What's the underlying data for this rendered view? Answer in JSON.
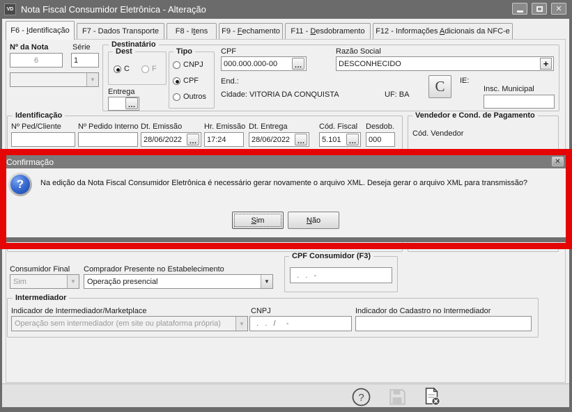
{
  "window": {
    "icon_text": "VD",
    "title": "Nota Fiscal Consumidor Eletrônica - Alteração"
  },
  "tabs": [
    {
      "label": "F6 - Identificação",
      "u": 5,
      "active": true
    },
    {
      "label": "F7 - Dados Transporte",
      "u": -1,
      "active": false
    },
    {
      "label": "F8 - Itens",
      "u": 6,
      "active": false
    },
    {
      "label": "F9 - Fechamento",
      "u": 5,
      "active": false
    },
    {
      "label": "F11 - Desdobramento",
      "u": 6,
      "active": false
    },
    {
      "label": "F12 - Informações Adicionais da NFC-e",
      "u": 18,
      "active": false
    }
  ],
  "form": {
    "nota": {
      "label": "Nº da Nota",
      "value": "6"
    },
    "serie": {
      "label": "Série",
      "value": "1"
    },
    "destinatario": {
      "title": "Destinatário",
      "dest": {
        "title": "Dest",
        "option_c": "C",
        "option_f": "F",
        "selected": "C"
      },
      "entrega_label": "Entrega",
      "entrega_value": "",
      "tipo": {
        "title": "Tipo",
        "options": [
          "CNPJ",
          "CPF",
          "Outros"
        ],
        "selected": "CPF"
      },
      "cpf": {
        "label": "CPF",
        "value": "000.000.000-00"
      },
      "razao_social": {
        "label": "Razão Social",
        "value": "DESCONHECIDO"
      },
      "end_label": "End.:",
      "cidade_text": "Cidade: VITORIA DA CONQUISTA",
      "uf_text": "UF: BA",
      "c_button_label": "C",
      "ie_label": "IE:",
      "insc_municipal_label": "Insc. Municipal",
      "insc_municipal_value": ""
    },
    "identificacao": {
      "title": "Identificação",
      "fields": [
        {
          "label": "Nº Ped/Cliente",
          "value": ""
        },
        {
          "label": "Nº Pedido Interno",
          "value": ""
        },
        {
          "label": "Dt. Emissão",
          "value": "28/06/2022"
        },
        {
          "label": "Hr. Emissão",
          "value": "17:24"
        },
        {
          "label": "Dt. Entrega",
          "value": "28/06/2022"
        },
        {
          "label": "Cód. Fiscal",
          "value": "5.101"
        },
        {
          "label": "Desdob.",
          "value": "000"
        }
      ]
    },
    "vendedor": {
      "title": "Vendedor e Cond. de Pagamento",
      "cod_vendedor_label": "Cód. Vendedor"
    },
    "consumidor": {
      "final_label": "Consumidor Final",
      "final_value": "Sim",
      "comprador_label": "Comprador Presente no Estabelecimento",
      "comprador_value": "Operação presencial",
      "cpf_group_title": "CPF Consumidor (F3)",
      "cpf_mask": "  .   .   -"
    },
    "intermediador": {
      "title": "Intermediador",
      "indicador_label": "Indicador de Intermediador/Marketplace",
      "indicador_value": "Operação sem intermediador (em site ou plataforma própria)",
      "cnpj_label": "CNPJ",
      "cnpj_mask": "  .   .   /     -",
      "cadastro_label": "Indicador do Cadastro no Intermediador",
      "cadastro_value": ""
    }
  },
  "dialog": {
    "title": "Confirmação",
    "message": "Na edição da Nota Fiscal Consumidor Eletrônica é necessário gerar novamente o arquivo XML. Deseja gerar o arquivo XML para transmissão?",
    "yes_label": "Sim",
    "yes_u": 0,
    "no_label": "Não",
    "no_u": 0
  },
  "colors": {
    "highlight_red": "#e60505",
    "dialog_icon_blue": "#3d6fd6",
    "titlebar_gray": "#6b6b6b",
    "dialog_titlebar_gray": "#7b7b7b"
  }
}
